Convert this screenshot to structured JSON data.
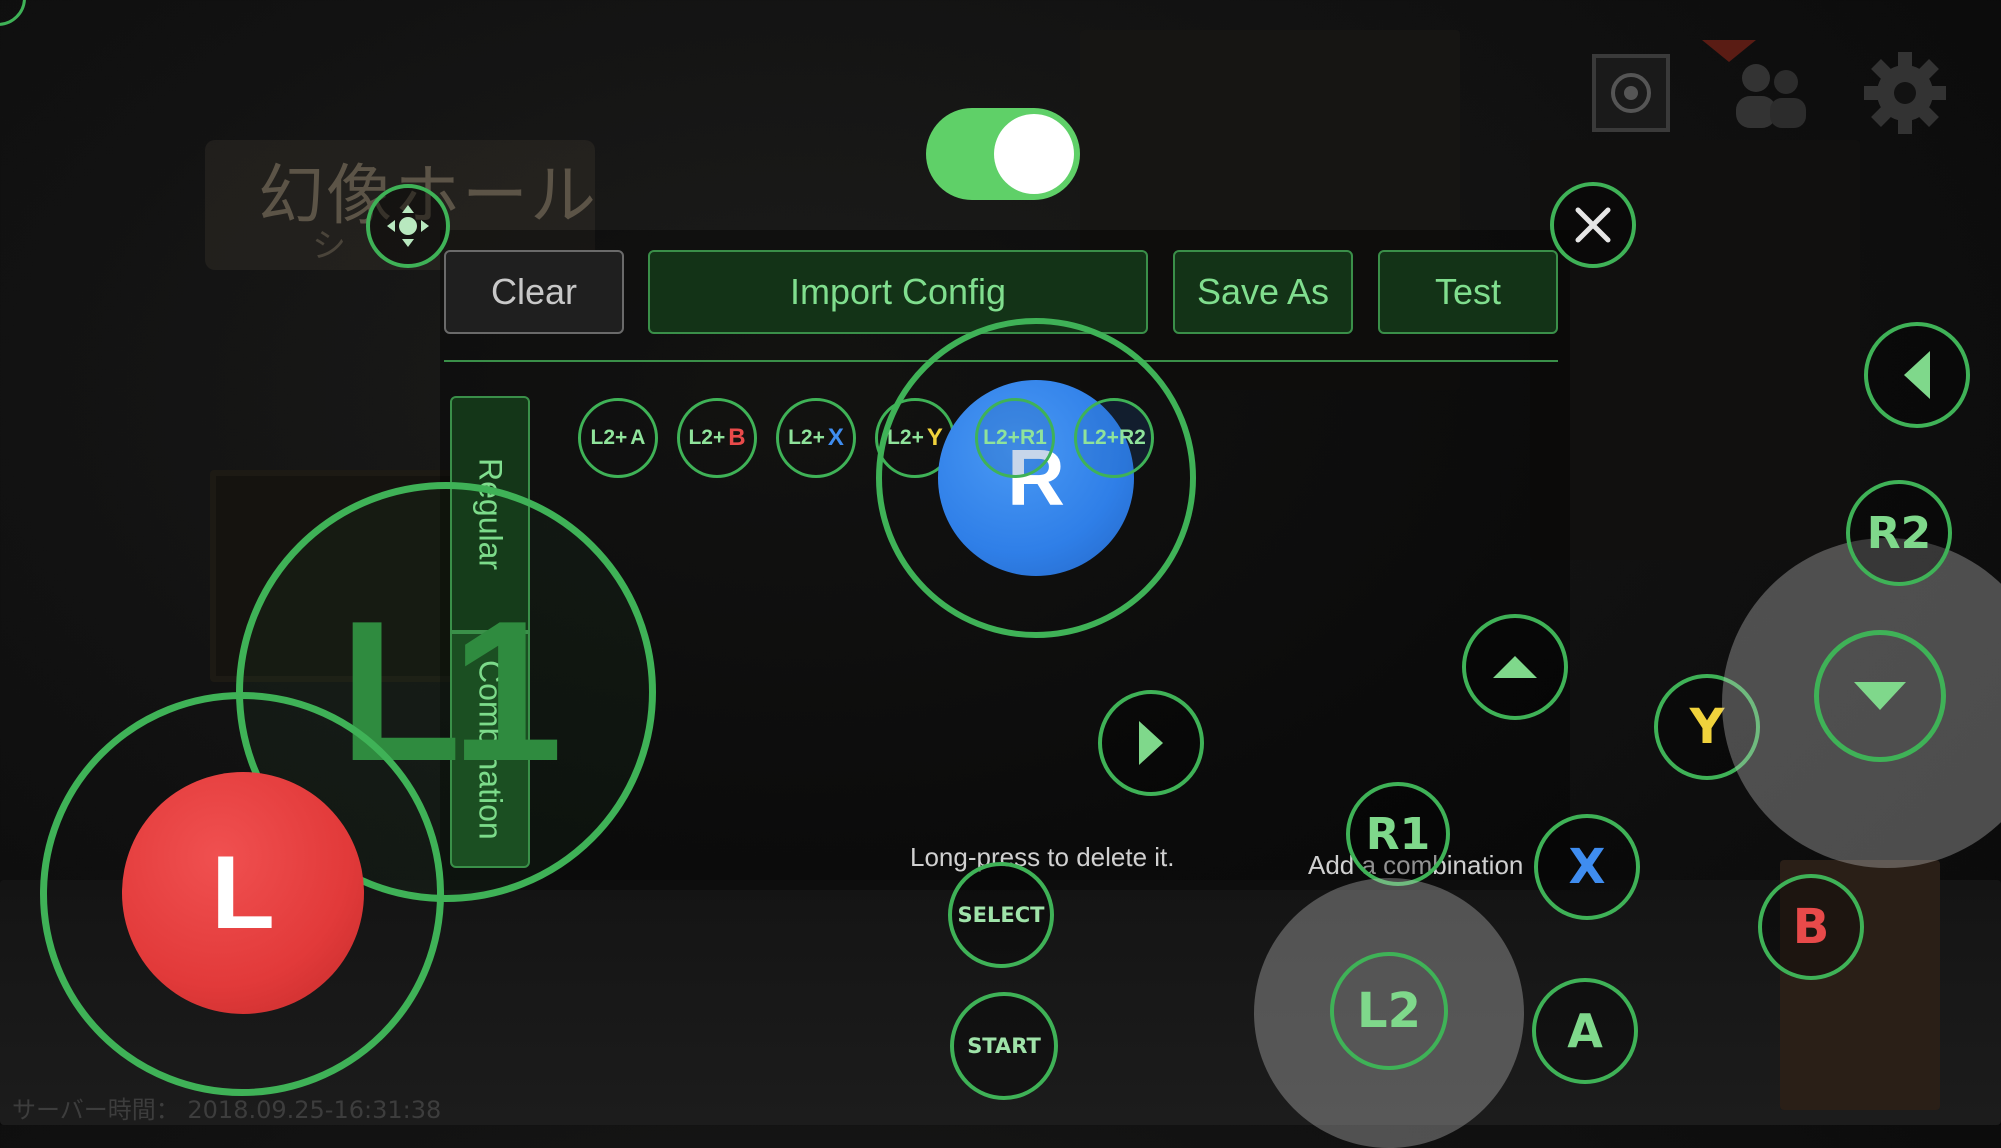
{
  "background": {
    "hall_title": "幻像ホール",
    "hall_subtitle": "シ",
    "server_time": "サーバー時間： 2018.09.25-16:31:38"
  },
  "panel": {
    "toggle_on": true,
    "buttons": {
      "clear": "Clear",
      "import_config": "Import Config",
      "save_as": "Save As",
      "test": "Test"
    },
    "tabs": {
      "regular": "Regular",
      "combination": "Combination"
    },
    "combos": [
      {
        "prefix": "L2+",
        "key": "A",
        "key_color": "#8fe39b"
      },
      {
        "prefix": "L2+",
        "key": "B",
        "key_color": "#e84a4a"
      },
      {
        "prefix": "L2+",
        "key": "X",
        "key_color": "#3f8df0"
      },
      {
        "prefix": "L2+",
        "key": "Y",
        "key_color": "#f0d23c"
      },
      {
        "prefix": "L2+",
        "key": "R1",
        "key_color": "#8fe39b"
      },
      {
        "prefix": "L2+",
        "key": "R2",
        "key_color": "#8fe39b"
      }
    ],
    "hint_delete": "Long-press to delete it.",
    "hint_add": "Add a combination"
  },
  "controls": {
    "left_stick": "L",
    "right_stick": "R",
    "l1": "L1",
    "l2": "L2",
    "r1": "R1",
    "r2": "R2",
    "select": "SELECT",
    "start": "START",
    "a": "A",
    "b": "B",
    "x": "X",
    "y": "Y"
  },
  "colors": {
    "accent": "#3fb257",
    "toggle_on": "#5fd068",
    "stick_left": "#e23a3a",
    "stick_right": "#2f7fe8",
    "btn_b": "#e84a4a",
    "btn_x": "#3f8df0",
    "btn_y": "#f0d23c"
  },
  "icons": {
    "move": "move-handle-icon",
    "close": "close-icon",
    "settings": "gear-icon",
    "friends": "friends-icon",
    "mail": "mail-icon",
    "emblem": "emblem-icon"
  }
}
